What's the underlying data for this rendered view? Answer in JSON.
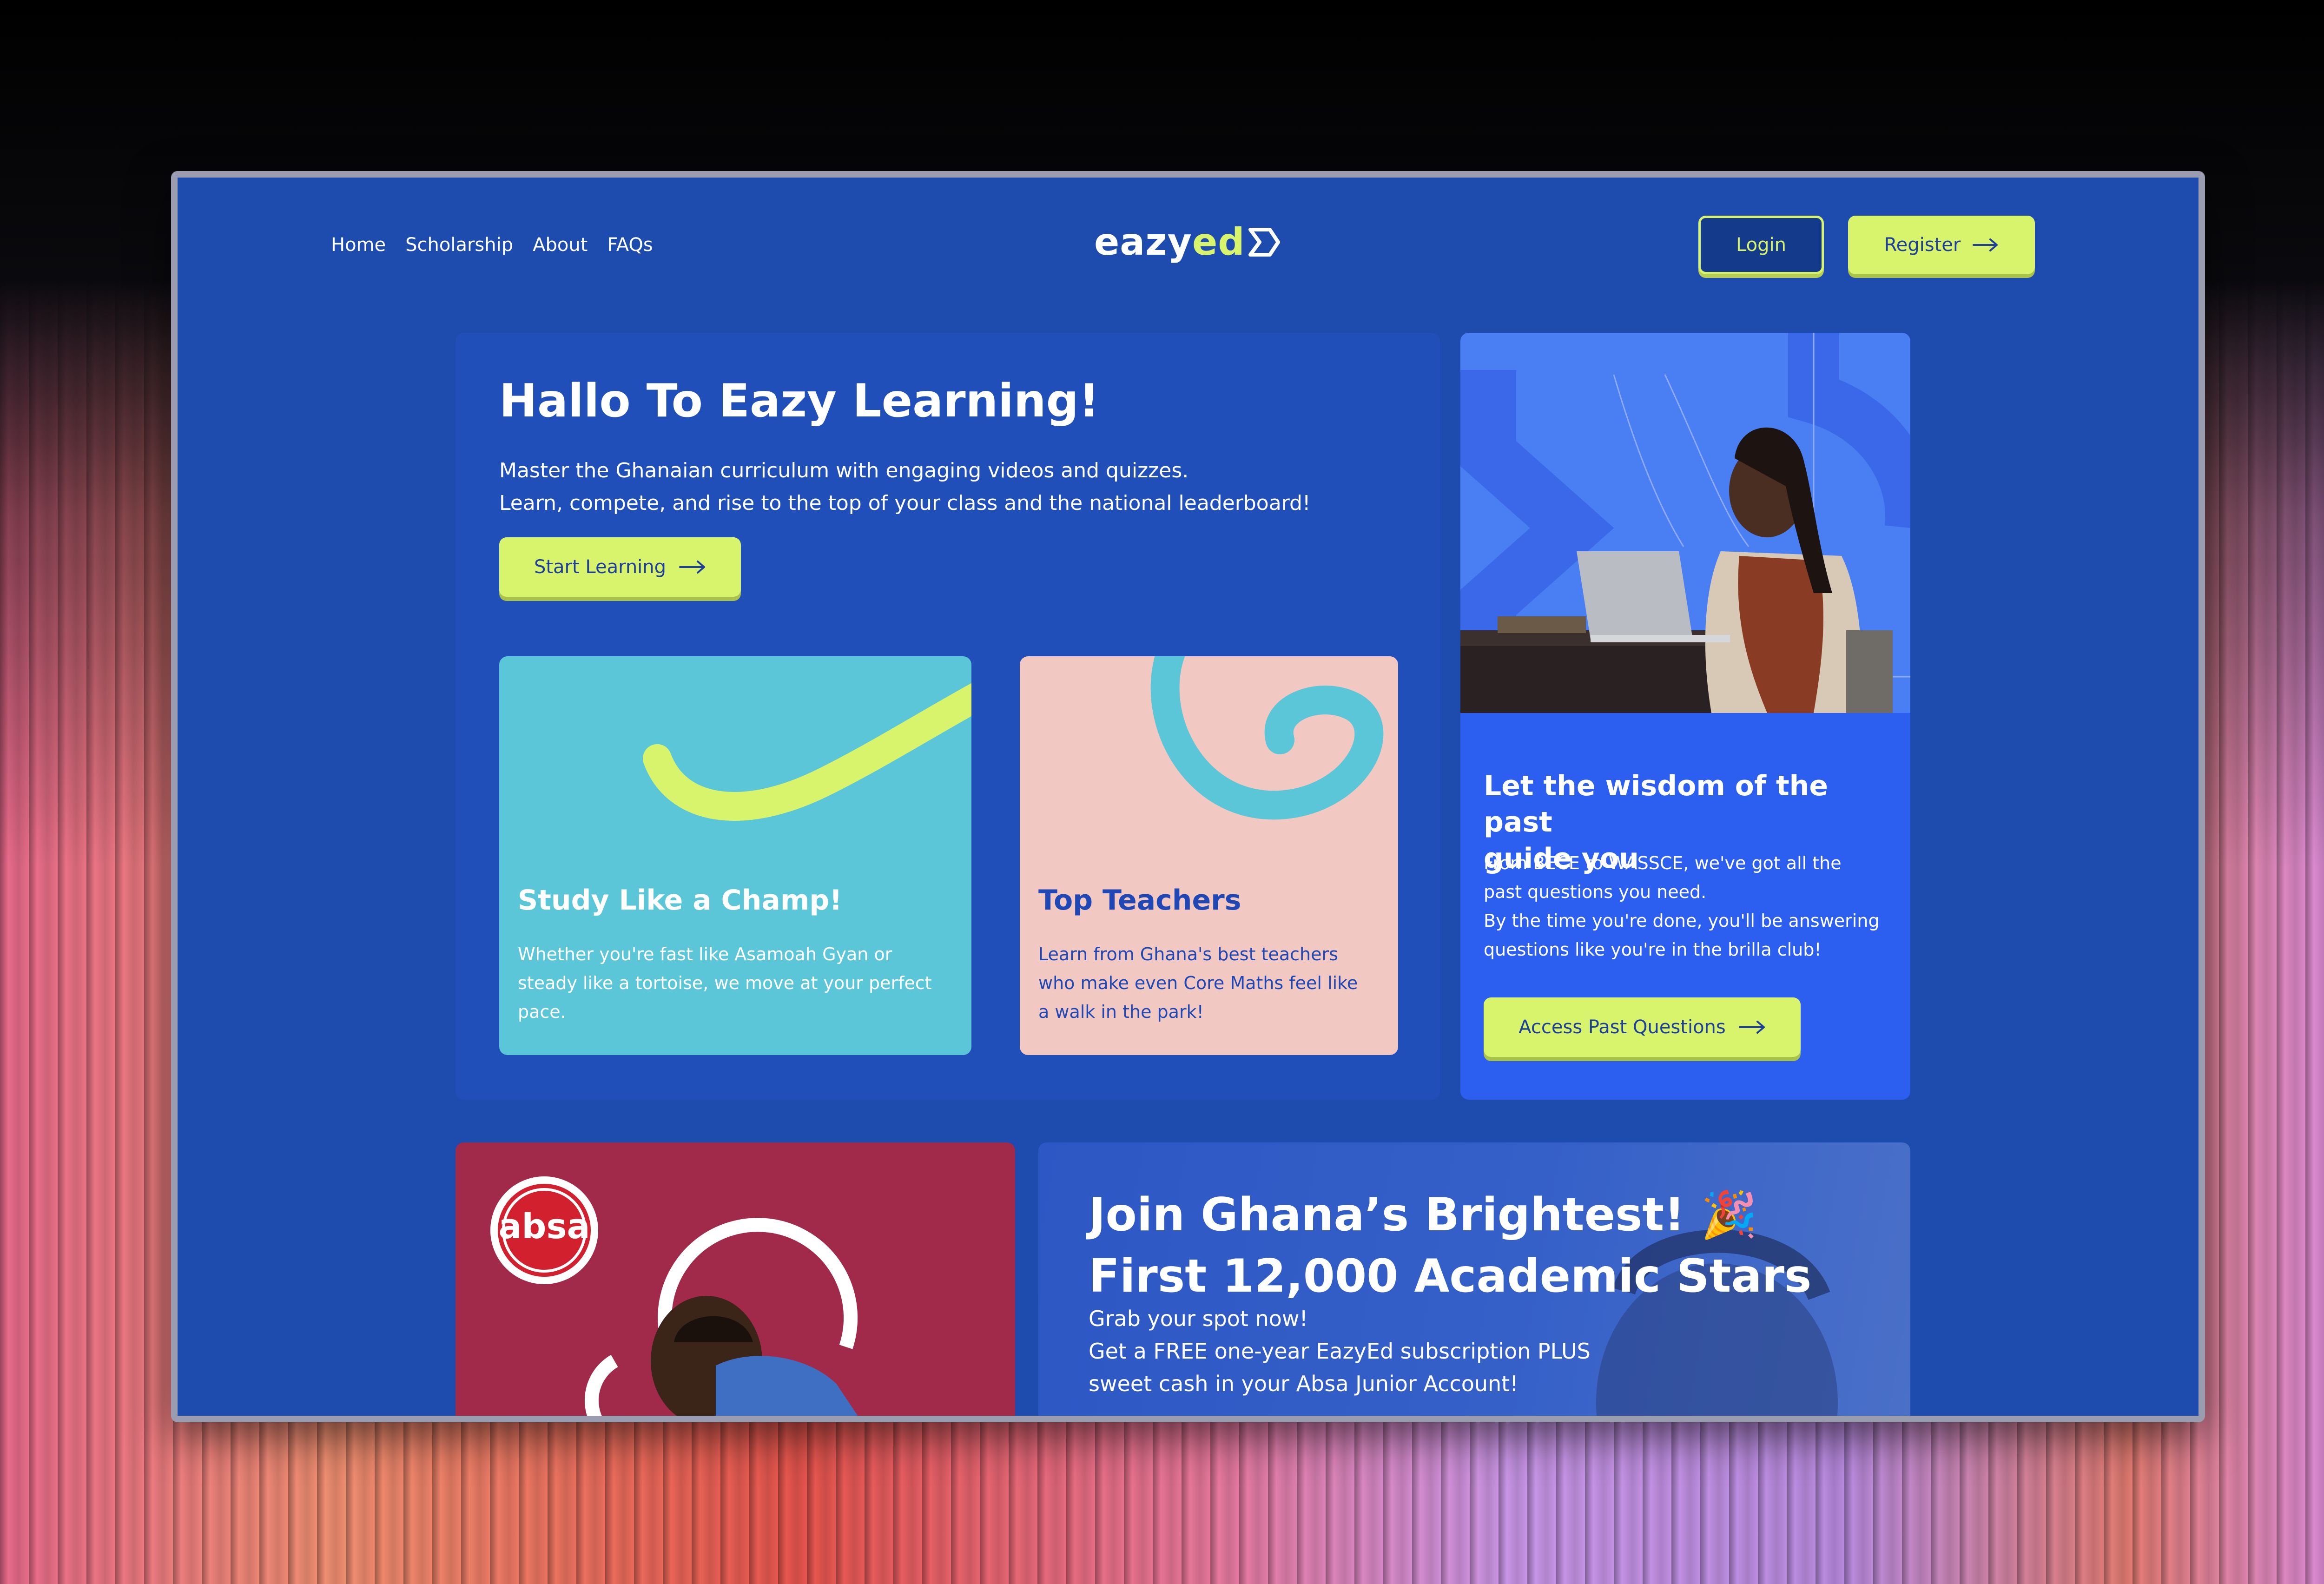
{
  "nav": {
    "links": [
      "Home",
      "Scholarship",
      "About",
      "FAQs"
    ],
    "logo_part1": "eazy",
    "logo_part2": "ed",
    "login": "Login",
    "register": "Register"
  },
  "hero": {
    "title": "Hallo To Eazy Learning!",
    "subtitle_line1": "Master the Ghanaian curriculum with engaging videos and quizzes.",
    "subtitle_line2": "Learn, compete, and rise to the top of your class and the national leaderboard!",
    "cta": "Start Learning"
  },
  "cards": {
    "champ": {
      "title": "Study Like a Champ!",
      "body_line1": "Whether you're fast like Asamoah Gyan or",
      "body_line2": "steady like a tortoise, we move at your perfect",
      "body_line3": "pace."
    },
    "teachers": {
      "title": "Top Teachers",
      "body_line1": "Learn from Ghana's best teachers",
      "body_line2": "who make even Core Maths feel like",
      "body_line3": "a walk in the park!"
    }
  },
  "wisdom": {
    "title_line1": "Let the wisdom of the past",
    "title_line2": "guide you",
    "body_line1": "From BECE to WASSCE, we've got all the",
    "body_line2": "past questions you need.",
    "body_line3": "By the time you're done, you'll be answering",
    "body_line4": "questions like you're in the brilla club!",
    "cta": "Access Past Questions"
  },
  "absa": {
    "logo_text": "absa"
  },
  "join": {
    "title_line1": "Join Ghana’s Brightest! 🎉",
    "title_line2": "First 12,000 Academic Stars",
    "body_line1": "Grab your spot now!",
    "body_line2": "Get a FREE one-year EazyEd subscription PLUS",
    "body_line3": "sweet cash in your Absa Junior Account!"
  },
  "colors": {
    "page_blue": "#1e4bae",
    "accent_lime": "#d8f36c",
    "card_cyan": "#5bc6d7",
    "card_pink": "#f2c9c2",
    "bright_blue": "#2c5fef",
    "absa_red": "#a12a4b"
  },
  "icons": [
    "arrow-right-icon",
    "logo-mark-icon"
  ]
}
